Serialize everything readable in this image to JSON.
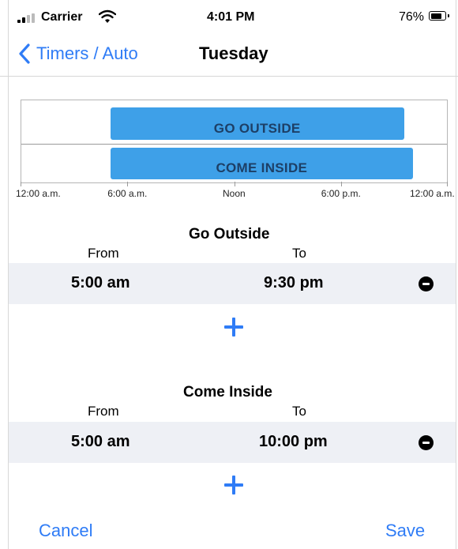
{
  "status_bar": {
    "carrier": "Carrier",
    "time": "4:01 PM",
    "battery_percent": "76%",
    "battery_level": 0.76,
    "signal_bars_active": 2
  },
  "nav": {
    "back_label": "Timers / Auto",
    "title": "Tuesday"
  },
  "chart_data": {
    "type": "timeline",
    "x_range_hours": [
      0,
      24
    ],
    "tick_labels": [
      "12:00 a.m.",
      "6:00 a.m.",
      "Noon",
      "6:00 p.m.",
      "12:00 a.m."
    ],
    "bars": [
      {
        "label": "GO OUTSIDE",
        "start_hour": 5.0,
        "end_hour": 21.5
      },
      {
        "label": "COME INSIDE",
        "start_hour": 5.0,
        "end_hour": 22.0
      }
    ],
    "bar_color": "#3ea0e8"
  },
  "schedules": [
    {
      "title": "Go Outside",
      "from_label": "From",
      "to_label": "To",
      "from": "5:00 am",
      "to": "9:30 pm"
    },
    {
      "title": "Come Inside",
      "from_label": "From",
      "to_label": "To",
      "from": "5:00 am",
      "to": "10:00 pm"
    }
  ],
  "footer": {
    "cancel_label": "Cancel",
    "save_label": "Save"
  },
  "colors": {
    "accent": "#2f7cf6",
    "row_background": "#eef0f5"
  }
}
